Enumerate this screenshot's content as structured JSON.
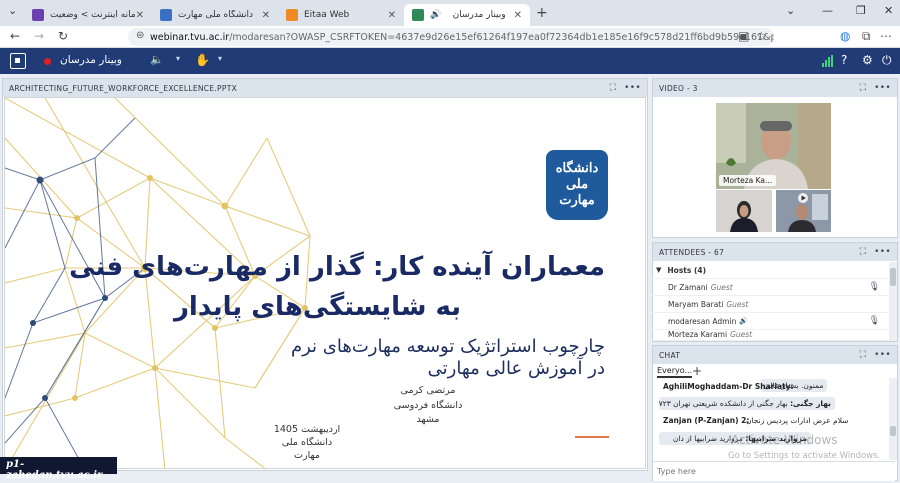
{
  "browser": {
    "tabs": [
      {
        "label": "سامانه اینترنت > وضعیت",
        "favicon_color": "#6a3fb0"
      },
      {
        "label": "دانشگاه ملی مهارت",
        "favicon_color": "#3a6fc4"
      },
      {
        "label": "Eitaa Web",
        "favicon_color": "#f08a24"
      },
      {
        "label": "وبینار مدرسان",
        "favicon_color": "#2e8b57"
      }
    ],
    "url_domain": "webinar.tvu.ac.ir",
    "url_rest": "/modaresan?OWASP_CSRFTOKEN=4637e9d26e15ef61264f197ea0f72364db1e185e16f9c578d21ff6bd9b59e161&proto=true"
  },
  "header": {
    "meeting_name": "وبینار مدرسان"
  },
  "share_panel": {
    "title": "ARCHITECTING_FUTURE_WORKFORCE_EXCELLENCE.PPTX",
    "menu": "•••"
  },
  "slide": {
    "emblem_text": "دانشگاه ملی مهارت",
    "title_line1": "معماران آینده کار: گذار از مهارت‌های فنی",
    "title_line2": "به شایستگی‌های پایدار",
    "subtitle_line1": "چارچوب استراتژیک توسعه مهارت‌های نرم",
    "subtitle_line2": "در آموزش عالی مهارتی",
    "author_lines": [
      "مرتضی کرمی",
      "دانشگاه فردوسی",
      "مشهد"
    ],
    "date_lines": [
      "اردیبهشت 1405",
      "دانشگاه ملی",
      "مهارت"
    ],
    "accent_color": "#e37a45",
    "title_color": "#1a2a64"
  },
  "video_panel": {
    "title": "VIDEO - 3",
    "main_name": "Morteza Ka..."
  },
  "attendees_panel": {
    "title": "ATTENDEES - 67",
    "group": "Hosts (4)",
    "rows": [
      {
        "name": "Dr Zamani",
        "role": "Guest"
      },
      {
        "name": "Maryam Barati",
        "role": "Guest"
      },
      {
        "name": "modaresan Admin",
        "role": ""
      },
      {
        "name": "Morteza Karami",
        "role": "Guest"
      }
    ]
  },
  "chat_panel": {
    "title": "CHAT",
    "tab_label": "Everyo...",
    "messages": [
      {
        "sender": "",
        "text": "ممنون. بسیار عالی"
      },
      {
        "sender": "AghiliMoghaddam-Dr Shariaty:",
        "text": ""
      },
      {
        "sender": "بهار جگنی:",
        "text": "بهار جگنی از دانشکده  شریعتی تهران  ۰۹۱۲۰۶۰۰۷۲۳"
      },
      {
        "sender": "Zanjan (P-Zanjan) 2:",
        "text": ""
      },
      {
        "sender": "",
        "text": "سلام عرض ادارات پردیس زنجان"
      },
      {
        "sender": "مروارید ضرابیها:",
        "text": "مروارید ضرابیها  از دان"
      }
    ],
    "input_placeholder": "Type here"
  },
  "os_watermark": {
    "line1": "Activate Windows",
    "line2": "Go to Settings to activate Windows."
  },
  "corner_badge": "p1-zahedan.tvu.ac.ir"
}
